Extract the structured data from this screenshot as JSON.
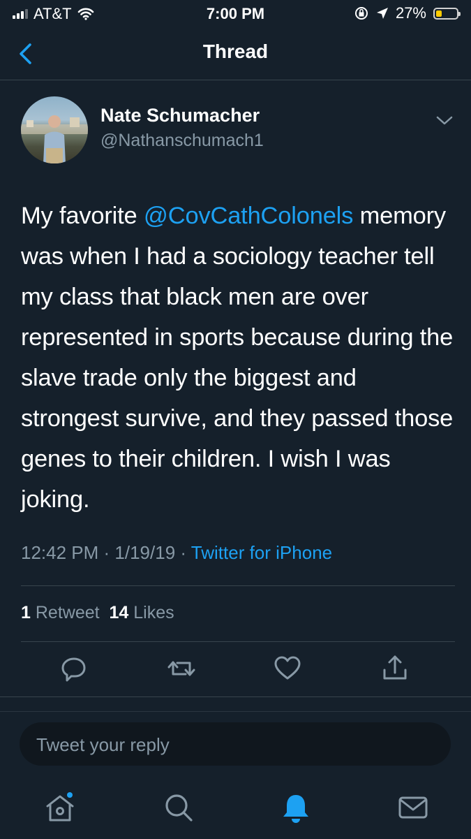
{
  "status_bar": {
    "carrier": "AT&T",
    "time": "7:00 PM",
    "battery": "27%",
    "battery_level": 0.27
  },
  "nav": {
    "title": "Thread",
    "back_icon": "chevron-left-icon"
  },
  "tweet": {
    "name": "Nate Schumacher",
    "handle": "@Nathanschumach1",
    "text_before": "My favorite ",
    "mention": "@CovCathColonels",
    "text_after": " memory was when I had a sociology teacher tell my class that black men are over represented in sports because during the slave trade only the biggest and strongest survive, and they passed those genes to their children. I wish I was joking.",
    "time": "12:42 PM",
    "date": "1/19/19",
    "source": "Twitter for iPhone",
    "retweet_count": "1",
    "retweet_label": "Retweet",
    "like_count": "14",
    "like_label": "Likes"
  },
  "reply": {
    "placeholder": "Tweet your reply"
  },
  "tab_bar": {
    "items": [
      "home-icon",
      "search-icon",
      "notifications-icon",
      "messages-icon"
    ],
    "active": "notifications-icon"
  },
  "colors": {
    "background": "#15202b",
    "accent": "#1da1f2",
    "secondary_text": "#8899a6",
    "divider": "#38444d",
    "battery": "#ffcc00"
  }
}
